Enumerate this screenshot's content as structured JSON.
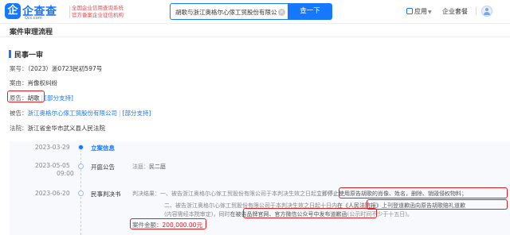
{
  "header": {
    "logo_glyph": "企",
    "logo_text": "企查查",
    "logo_sub": "Qcc.com",
    "slogan_line1": "全国企业信用查询系统",
    "slogan_line2": "官方备案企业征信机构",
    "search_value": "胡歌与浙江奥格尔心傢工贸股份有限公司肖像权纠纷的",
    "search_button": "查一下",
    "app_label": "应用",
    "biz_label": "企业套餐"
  },
  "section": {
    "title": "案件审理流程",
    "case_title": "民事一审"
  },
  "case": {
    "case_no_label": "案号：",
    "case_no": "（2023）浙0723民初597号",
    "cause_label": "案由：",
    "cause": "肖像权纠纷",
    "plaintiff_label": "原告：",
    "plaintiff": "胡歌",
    "plaintiff_result": "[部分支持]",
    "defendant_label": "被告：",
    "defendant": "浙江奥格尔心傢工贸股份有限公司",
    "defendant_result": "[部分支持]",
    "court_label": "法院：",
    "court": "浙江省金华市武义县人民法院"
  },
  "timeline": [
    {
      "date": "2023-03-29",
      "stage": "立案信息",
      "active": true
    },
    {
      "date": "2023-05-05",
      "date_sub": "09:00",
      "stage": "开庭公告",
      "detail_label": "法庭：",
      "detail": "民二庭"
    },
    {
      "date": "2023-06-20",
      "stage": "民事判决书"
    }
  ],
  "judgment": {
    "label": "判决结果：",
    "line1_a": "一、被告浙江奥格尔心傢工贸股份有限公司于本判决生效之日起",
    "line1_b": "立即停止使用原告胡歌的肖像、姓名，删除、销毁侵权物料；",
    "line2_a": "二、被告浙江奥格尔心傢工贸股份有限公司于本判决生效之日起十日内",
    "line2_b": "在《人民法院报》上刊登道歉函向原告胡歌赔礼道歉",
    "line3_a": "(内容需经本院审定)，同时",
    "line3_b": "在被告品牌官网、官方微信公众号中发布道歉函",
    "line3_c": "(公示时间不少于十五日)。"
  },
  "amount": {
    "label": "案件金额：",
    "value": "200,000.00元"
  },
  "colors": {
    "accent": "#1677ff",
    "highlight_box": "#e02020"
  }
}
